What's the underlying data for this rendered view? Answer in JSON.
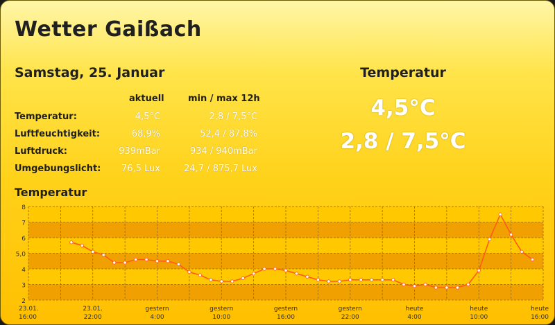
{
  "title": "Wetter Gaißach",
  "date": "Samstag, 25. Januar",
  "table": {
    "col_current": "aktuell",
    "col_minmax": "min / max 12h",
    "rows": [
      {
        "label": "Temperatur:",
        "current": "4,5°C",
        "minmax": "2,8 / 7,5°C"
      },
      {
        "label": "Luftfeuchtigkeit:",
        "current": "68,9%",
        "minmax": "52,4 / 87,8%"
      },
      {
        "label": "Luftdruck:",
        "current": "939mBar",
        "minmax": "934 / 940mBar"
      },
      {
        "label": "Umgebungslicht:",
        "current": "76,5 Lux",
        "minmax": "24,7 / 875,7 Lux"
      }
    ]
  },
  "summary": {
    "title": "Temperatur",
    "current": "4,5°C",
    "minmax": "2,8 / 7,5°C"
  },
  "colors": {
    "line": "#ff5a1a",
    "band_dark": "#f0a000",
    "band_light": "#ffc800"
  },
  "chart_data": {
    "type": "line",
    "title": "Temperatur",
    "ylim": [
      2,
      8
    ],
    "y_ticks": [
      "2",
      "3",
      "4",
      "5,0",
      "6",
      "7",
      "8"
    ],
    "x_ticks": [
      [
        "23.01.",
        "16:00"
      ],
      [
        "23.01.",
        "22:00"
      ],
      [
        "gestern",
        "4:00"
      ],
      [
        "gestern",
        "10:00"
      ],
      [
        "gestern",
        "16:00"
      ],
      [
        "gestern",
        "22:00"
      ],
      [
        "heute",
        "4:00"
      ],
      [
        "heute",
        "10:00"
      ],
      [
        "heute",
        "16:00"
      ]
    ],
    "x_hours": [
      0,
      6,
      12,
      18,
      24,
      30,
      36,
      42,
      48
    ],
    "grid": true,
    "series": [
      {
        "x": [
          4,
          5,
          6,
          7,
          8,
          9,
          10,
          11,
          12,
          13,
          14,
          15,
          16,
          17,
          18,
          19,
          20,
          21,
          22,
          23,
          24,
          25,
          26,
          27,
          28,
          29,
          30,
          31,
          32,
          33,
          34,
          35,
          36,
          37,
          38,
          39,
          40,
          41,
          42,
          43,
          44,
          45,
          46,
          47
        ],
        "y": [
          5.7,
          5.5,
          5.1,
          4.9,
          4.4,
          4.4,
          4.6,
          4.6,
          4.5,
          4.5,
          4.3,
          3.8,
          3.6,
          3.3,
          3.2,
          3.2,
          3.4,
          3.7,
          4.0,
          4.0,
          3.9,
          3.7,
          3.5,
          3.3,
          3.2,
          3.2,
          3.3,
          3.3,
          3.3,
          3.3,
          3.3,
          3.0,
          2.9,
          3.0,
          2.8,
          2.8,
          2.8,
          3.0,
          3.9,
          5.9,
          7.5,
          6.2,
          5.1,
          4.6
        ]
      }
    ]
  }
}
